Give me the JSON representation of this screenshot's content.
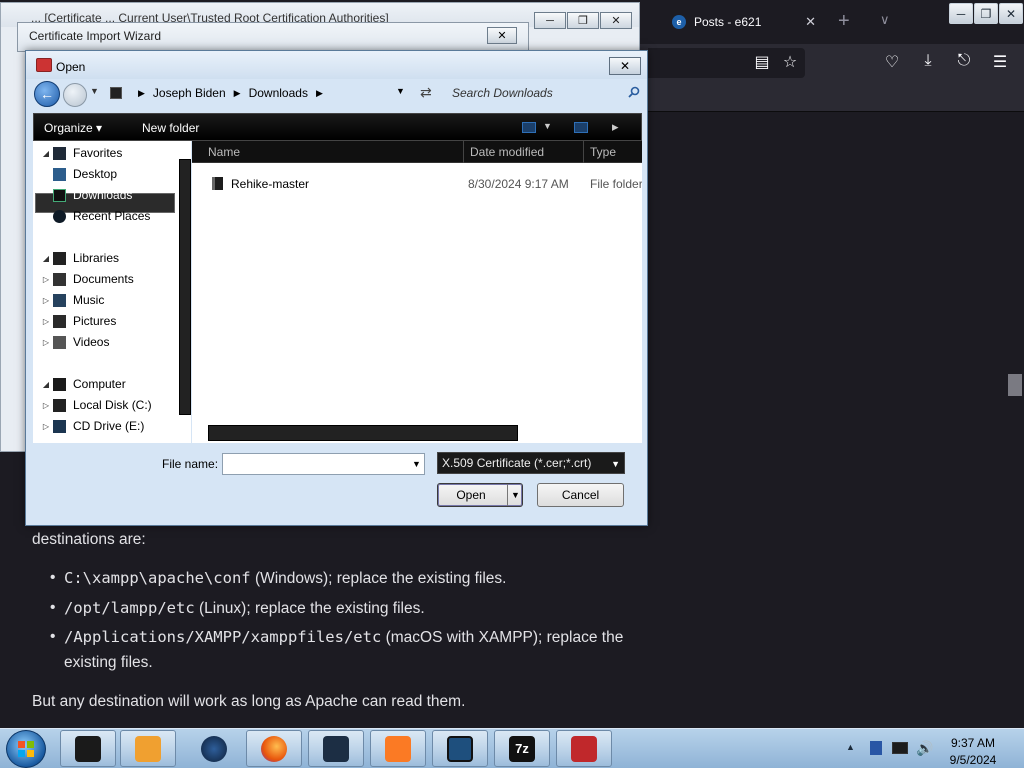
{
  "firefox": {
    "tab_title": "Posts - e621",
    "tab_favicon": "e",
    "new_tab_label": "+",
    "tab_list_label": "∨",
    "close_tab_label": "✕",
    "article": {
      "intro_text": "destinations are:",
      "items": [
        {
          "code": "C:\\xampp\\apache\\conf",
          "text": " (Windows); replace the existing files."
        },
        {
          "code": "/opt/lampp/etc",
          "text": " (Linux); replace the existing files."
        },
        {
          "code": "/Applications/XAMPP/xamppfiles/etc",
          "text": " (macOS with XAMPP); replace the existing files."
        }
      ],
      "outro_text": "But any destination will work as long as Apache can read them."
    }
  },
  "wizard": {
    "title": "Certificate Import Wizard",
    "background_title": "... [Certificate ... Current User\\Trusted Root Certification Authorities]"
  },
  "open_dialog": {
    "title": "Open",
    "close_label": "✕",
    "breadcrumb": [
      "Joseph Biden",
      "Downloads"
    ],
    "search_placeholder": "Search Downloads",
    "toolbar": {
      "organize": "Organize ▾",
      "new_folder": "New folder"
    },
    "nav": {
      "favorites": "Favorites",
      "desktop": "Desktop",
      "downloads": "Downloads",
      "recent_places": "Recent Places",
      "libraries": "Libraries",
      "documents": "Documents",
      "music": "Music",
      "pictures": "Pictures",
      "videos": "Videos",
      "computer": "Computer",
      "local_disk": "Local Disk (C:)",
      "cd_drive": "CD Drive (E:)"
    },
    "columns": {
      "name": "Name",
      "date_modified": "Date modified",
      "type": "Type"
    },
    "files": [
      {
        "name": "Rehike-master",
        "date": "8/30/2024 9:17 AM",
        "type": "File folder"
      }
    ],
    "filename_label": "File name:",
    "filename_value": "",
    "filetype": "X.509 Certificate (*.cer;*.crt)",
    "open_label": "Open",
    "cancel_label": "Cancel"
  },
  "taskbar": {
    "clock_time": "9:37 AM",
    "clock_date": "9/5/2024"
  },
  "colors": {
    "firefox_bg": "#1c1b22",
    "taskbar": "#8fb3d6",
    "dialog_frame": "#d6e5f5"
  }
}
